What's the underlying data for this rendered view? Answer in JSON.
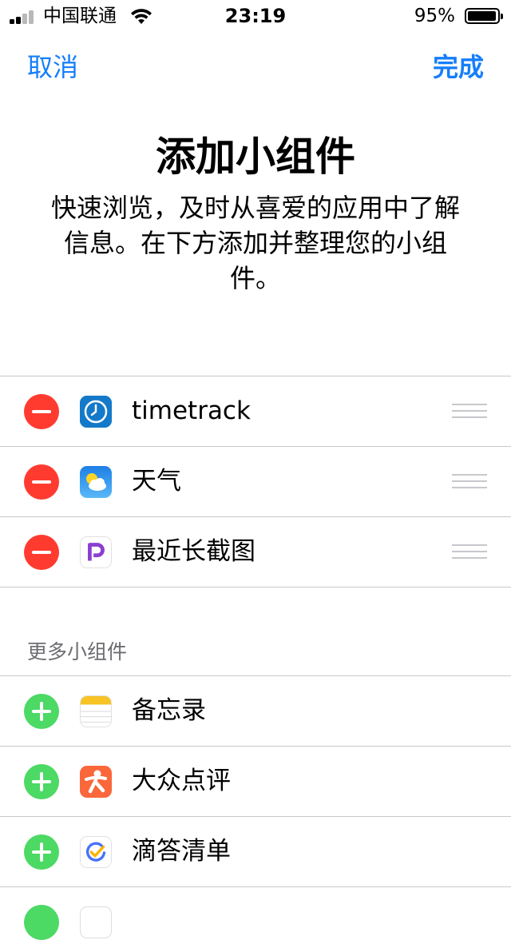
{
  "status_bar": {
    "carrier": "中国联通",
    "time": "23:19",
    "battery_percent": "95%",
    "signal_bars": 4,
    "signal_bars_filled": 2,
    "battery_level": 0.95
  },
  "nav": {
    "cancel_label": "取消",
    "done_label": "完成",
    "accent_color": "#157efb"
  },
  "header": {
    "title": "添加小组件",
    "subtitle": "快速浏览，及时从喜爱的应用中了解信息。在下方添加并整理您的小组件。"
  },
  "active_widgets": [
    {
      "name": "timetrack",
      "icon": "timetrack-clock-icon"
    },
    {
      "name": "天气",
      "icon": "weather-icon"
    },
    {
      "name": "最近长截图",
      "icon": "longshot-p-icon"
    }
  ],
  "more_section": {
    "header": "更多小组件",
    "items": [
      {
        "name": "备忘录",
        "icon": "notes-icon"
      },
      {
        "name": "大众点评",
        "icon": "dianping-icon"
      },
      {
        "name": "滴答清单",
        "icon": "ticktick-icon"
      }
    ]
  },
  "colors": {
    "remove": "#ff3b30",
    "add": "#4cd964",
    "separator": "#c8c7cc"
  }
}
